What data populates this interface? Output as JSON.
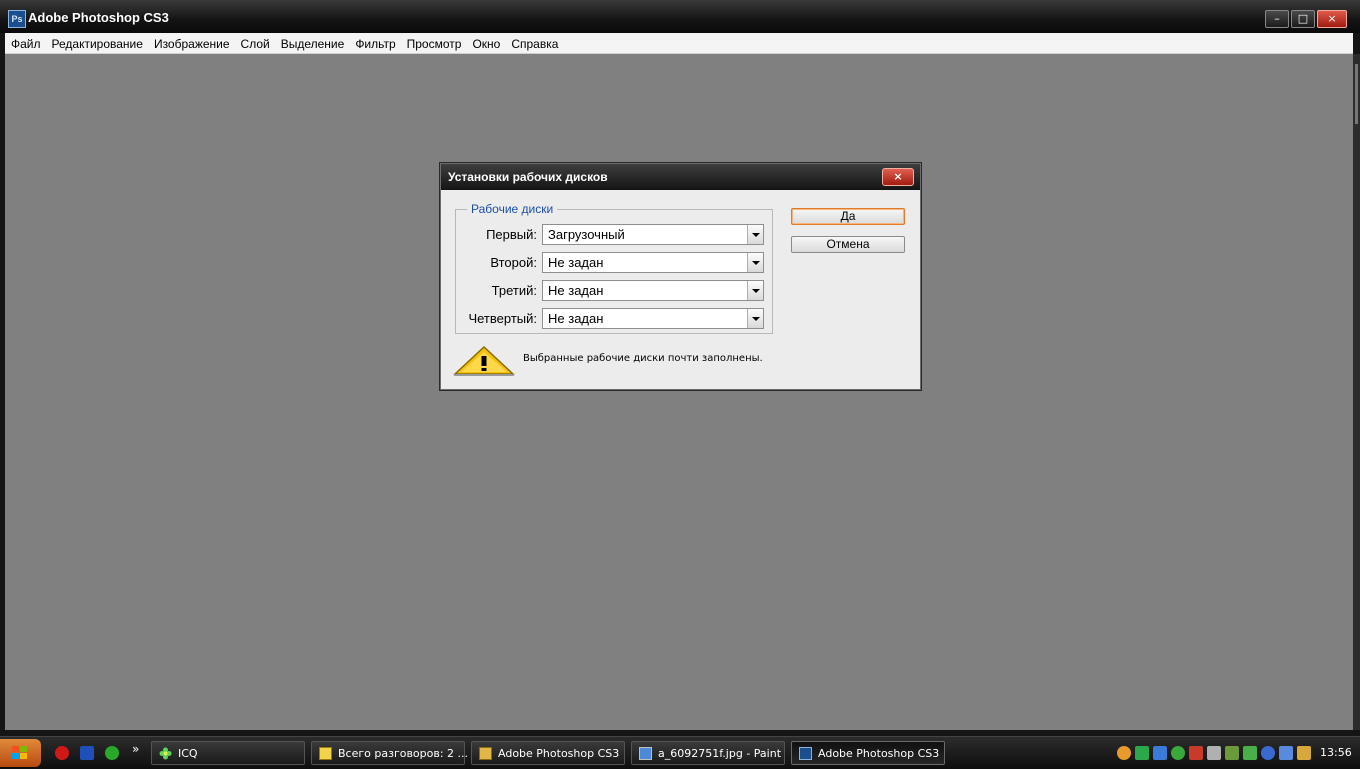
{
  "window": {
    "title": "Adobe Photoshop CS3",
    "icon_text": "Ps",
    "controls": {
      "minimize": "–",
      "maximize": "□",
      "close": "×"
    }
  },
  "menu": [
    "Файл",
    "Редактирование",
    "Изображение",
    "Слой",
    "Выделение",
    "Фильтр",
    "Просмотр",
    "Окно",
    "Справка"
  ],
  "dialog": {
    "title": "Установки рабочих дисков",
    "close_glyph": "×",
    "group_label": "Рабочие диски",
    "rows": [
      {
        "label": "Первый:",
        "value": "Загрузочный"
      },
      {
        "label": "Второй:",
        "value": "Не задан"
      },
      {
        "label": "Третий:",
        "value": "Не задан"
      },
      {
        "label": "Четвертый:",
        "value": "Не задан"
      }
    ],
    "ok_label": "Да",
    "cancel_label": "Отмена",
    "warning_text": "Выбранные рабочие диски почти заполнены."
  },
  "taskbar": {
    "more_glyph": "»",
    "tasks": [
      {
        "label": "ICQ",
        "icon": "icq-flower-icon"
      },
      {
        "label": "Всего разговоров: 2 ...",
        "icon": "chat-envelope-icon"
      },
      {
        "label": "Adobe Photoshop CS3",
        "icon": "folder-icon"
      },
      {
        "label": "a_6092751f.jpg - Paint",
        "icon": "paint-icon"
      },
      {
        "label": "Adobe Photoshop CS3",
        "icon": "photoshop-icon",
        "active": true
      }
    ],
    "clock": "13:56"
  },
  "colors": {
    "workspace": "#808080",
    "dialog_bg": "#ececec",
    "group_label": "#1c4fa8",
    "default_button_border": "#e27a2b",
    "start_button": "#d06a24"
  }
}
